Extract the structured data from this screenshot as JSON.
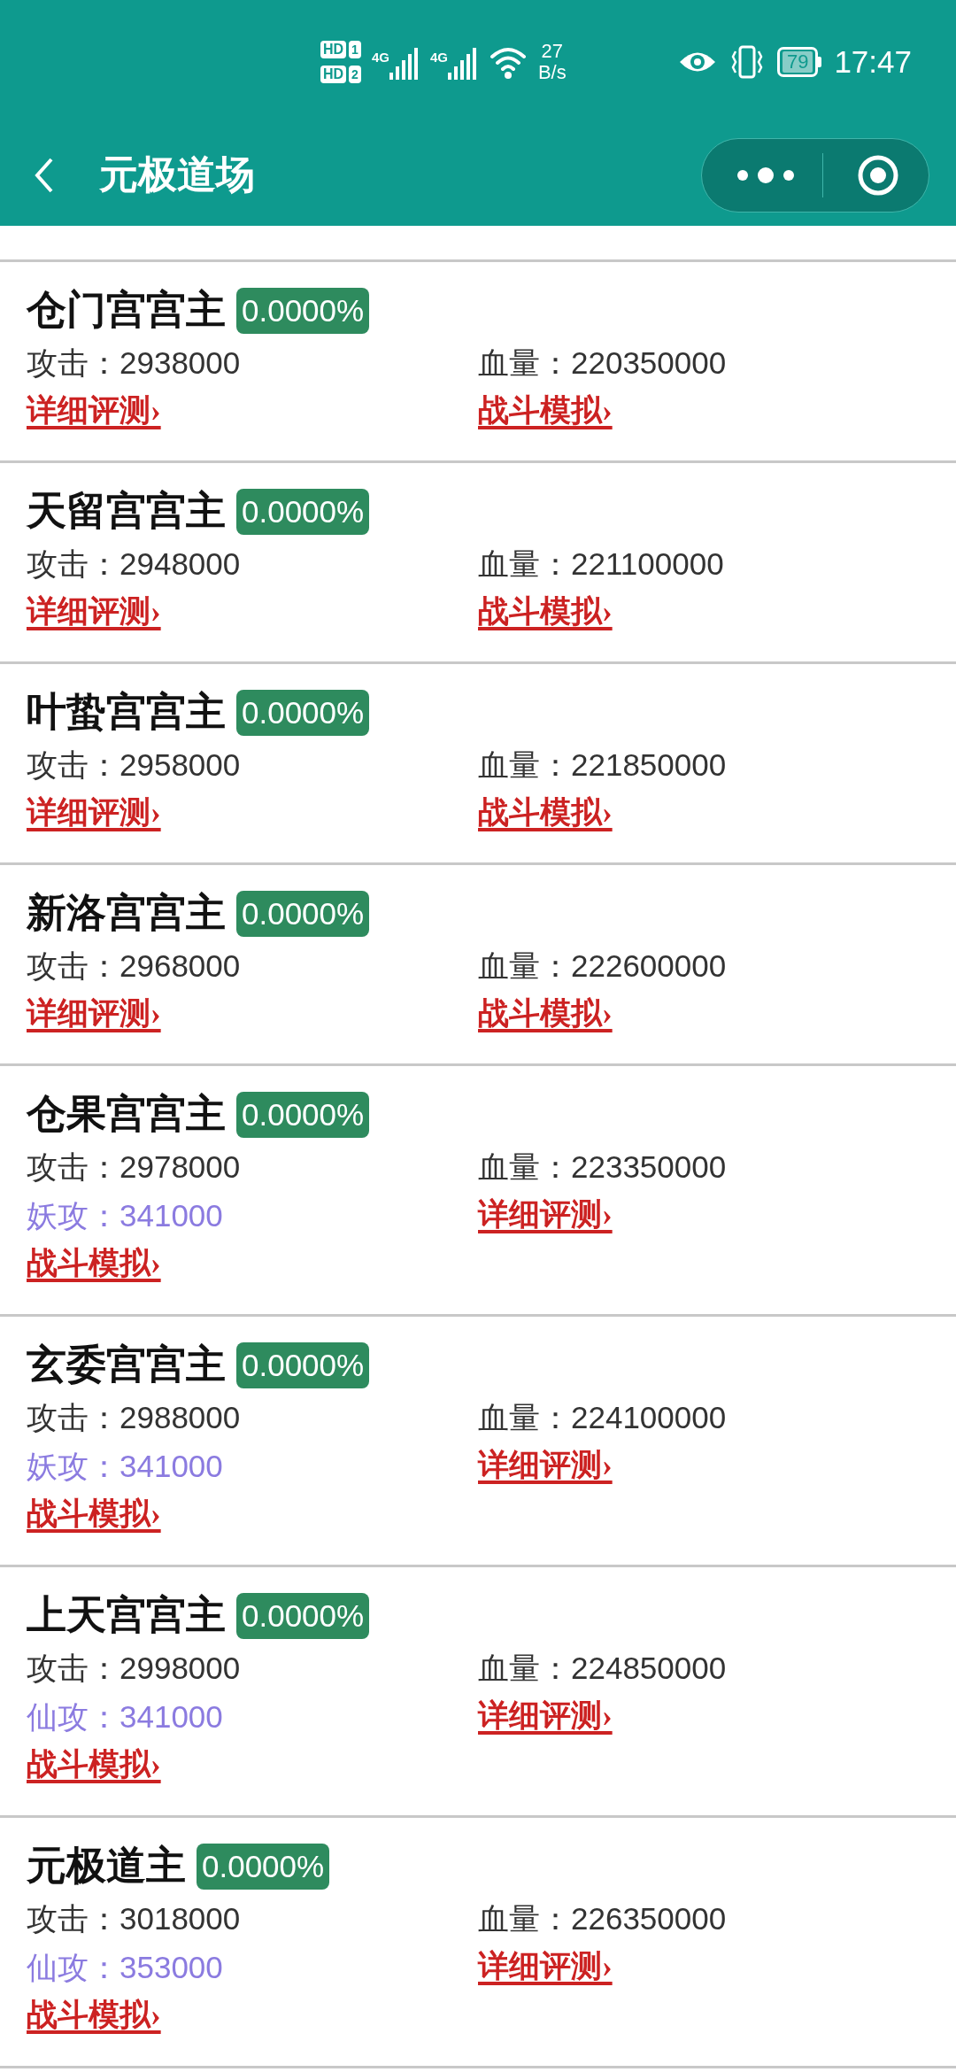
{
  "status_bar": {
    "sim_1": "1",
    "sim_2": "2",
    "hd_1": "HD",
    "hd_2": "HD",
    "network_1": "4G",
    "network_2": "4G",
    "speed_value": "27",
    "speed_unit": "B/s",
    "battery": "79",
    "time": "17:47"
  },
  "nav": {
    "title": "元极道场"
  },
  "cards": [
    {
      "name": "仓门宫宫主",
      "badge": "0.0000%",
      "cells": [
        {
          "kind": "stat",
          "text": "攻击：2938000"
        },
        {
          "kind": "stat",
          "text": "血量：220350000"
        },
        {
          "kind": "link",
          "text": "详细评测›"
        },
        {
          "kind": "link",
          "text": "战斗模拟›"
        }
      ]
    },
    {
      "name": "天留宫宫主",
      "badge": "0.0000%",
      "cells": [
        {
          "kind": "stat",
          "text": "攻击：2948000"
        },
        {
          "kind": "stat",
          "text": "血量：221100000"
        },
        {
          "kind": "link",
          "text": "详细评测›"
        },
        {
          "kind": "link",
          "text": "战斗模拟›"
        }
      ]
    },
    {
      "name": "叶蛰宫宫主",
      "badge": "0.0000%",
      "cells": [
        {
          "kind": "stat",
          "text": "攻击：2958000"
        },
        {
          "kind": "stat",
          "text": "血量：221850000"
        },
        {
          "kind": "link",
          "text": "详细评测›"
        },
        {
          "kind": "link",
          "text": "战斗模拟›"
        }
      ]
    },
    {
      "name": "新洛宫宫主",
      "badge": "0.0000%",
      "cells": [
        {
          "kind": "stat",
          "text": "攻击：2968000"
        },
        {
          "kind": "stat",
          "text": "血量：222600000"
        },
        {
          "kind": "link",
          "text": "详细评测›"
        },
        {
          "kind": "link",
          "text": "战斗模拟›"
        }
      ]
    },
    {
      "name": "仓果宫宫主",
      "badge": "0.0000%",
      "cells": [
        {
          "kind": "stat",
          "text": "攻击：2978000"
        },
        {
          "kind": "stat",
          "text": "血量：223350000"
        },
        {
          "kind": "bonus",
          "text": "妖攻：341000"
        },
        {
          "kind": "link",
          "text": "详细评测›"
        },
        {
          "kind": "link",
          "text": "战斗模拟›"
        }
      ]
    },
    {
      "name": "玄委宫宫主",
      "badge": "0.0000%",
      "cells": [
        {
          "kind": "stat",
          "text": "攻击：2988000"
        },
        {
          "kind": "stat",
          "text": "血量：224100000"
        },
        {
          "kind": "bonus",
          "text": "妖攻：341000"
        },
        {
          "kind": "link",
          "text": "详细评测›"
        },
        {
          "kind": "link",
          "text": "战斗模拟›"
        }
      ]
    },
    {
      "name": "上天宫宫主",
      "badge": "0.0000%",
      "cells": [
        {
          "kind": "stat",
          "text": "攻击：2998000"
        },
        {
          "kind": "stat",
          "text": "血量：224850000"
        },
        {
          "kind": "bonus",
          "text": "仙攻：341000"
        },
        {
          "kind": "link",
          "text": "详细评测›"
        },
        {
          "kind": "link",
          "text": "战斗模拟›"
        }
      ]
    },
    {
      "name": "元极道主",
      "badge": "0.0000%",
      "cells": [
        {
          "kind": "stat",
          "text": "攻击：3018000"
        },
        {
          "kind": "stat",
          "text": "血量：226350000"
        },
        {
          "kind": "bonus",
          "text": "仙攻：353000"
        },
        {
          "kind": "link",
          "text": "详细评测›"
        },
        {
          "kind": "link",
          "text": "战斗模拟›"
        }
      ]
    }
  ]
}
